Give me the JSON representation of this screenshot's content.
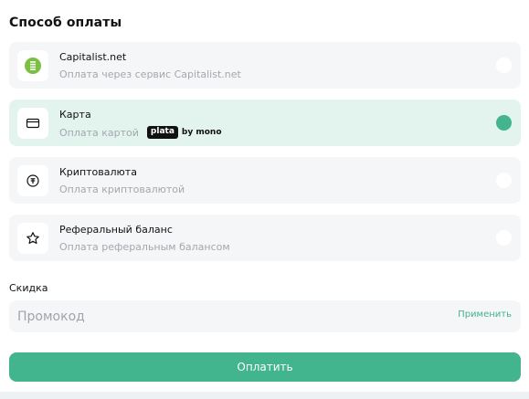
{
  "payment": {
    "title": "Способ оплаты",
    "methods": [
      {
        "name": "Capitalist.net",
        "description": "Оплата через сервис Capitalist.net",
        "icon": "capitalist-icon",
        "selected": false
      },
      {
        "name": "Карта",
        "description": "Оплата картой",
        "icon": "credit-card-icon",
        "selected": true,
        "badge": "plata",
        "badge_suffix": "by mono"
      },
      {
        "name": "Криптовалюта",
        "description": "Оплата криптовалютой",
        "icon": "crypto-coin-icon",
        "selected": false
      },
      {
        "name": "Реферальный баланс",
        "description": "Оплата реферальным балансом",
        "icon": "star-icon",
        "selected": false
      }
    ]
  },
  "discount": {
    "label": "Скидка",
    "placeholder": "Промокод",
    "value": "",
    "apply_label": "Применить"
  },
  "pay_label": "Оплатить",
  "colors": {
    "accent": "#42b48e",
    "selected_bg": "#e3f3ee",
    "card_bg": "#f5f6f8",
    "capitalist_green": "#7bc043"
  }
}
